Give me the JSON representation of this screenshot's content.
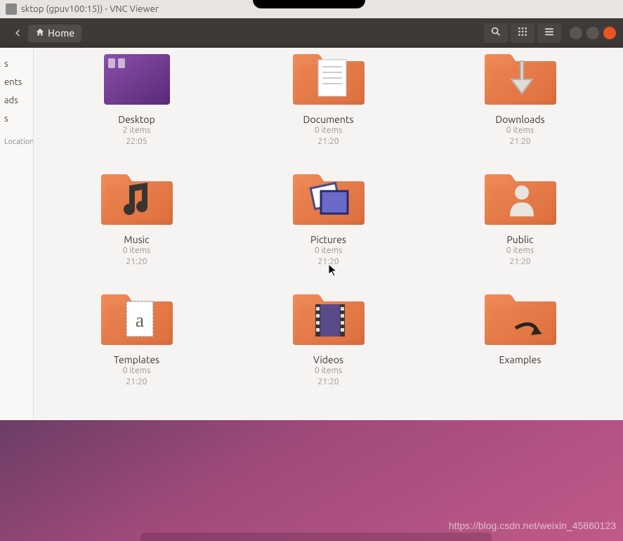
{
  "window": {
    "title": "sktop (gpuv100:15)) - VNC Viewer"
  },
  "toolbar": {
    "home_label": "Home"
  },
  "sidebar": {
    "items": [
      {
        "label": "s"
      },
      {
        "label": "ents"
      },
      {
        "label": "ads"
      },
      {
        "label": "s"
      }
    ],
    "heading": "Locations"
  },
  "folders": [
    {
      "name": "Desktop",
      "items": "2 items",
      "time": "22:05",
      "kind": "desktop"
    },
    {
      "name": "Documents",
      "items": "0 items",
      "time": "21:20",
      "kind": "documents"
    },
    {
      "name": "Downloads",
      "items": "0 items",
      "time": "21:20",
      "kind": "downloads"
    },
    {
      "name": "Music",
      "items": "0 items",
      "time": "21:20",
      "kind": "music"
    },
    {
      "name": "Pictures",
      "items": "0 items",
      "time": "21:20",
      "kind": "pictures"
    },
    {
      "name": "Public",
      "items": "0 items",
      "time": "21:20",
      "kind": "public"
    },
    {
      "name": "Templates",
      "items": "0 items",
      "time": "21:20",
      "kind": "templates"
    },
    {
      "name": "Videos",
      "items": "0 items",
      "time": "21:20",
      "kind": "videos"
    },
    {
      "name": "Examples",
      "items": "",
      "time": "",
      "kind": "examples"
    }
  ],
  "watermark": "https://blog.csdn.net/weixin_45860123"
}
